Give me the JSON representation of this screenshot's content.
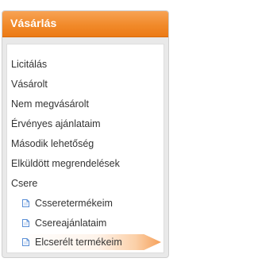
{
  "panel": {
    "title": "Vásárlás"
  },
  "menu": {
    "items": [
      {
        "label": "Licitálás"
      },
      {
        "label": "Vásárolt"
      },
      {
        "label": "Nem megvásárolt"
      },
      {
        "label": "Érvényes ajánlataim"
      },
      {
        "label": "Második lehetőség"
      },
      {
        "label": "Elküldött megrendelések"
      },
      {
        "label": "Csere"
      }
    ],
    "subitems": [
      {
        "label": "Csseretermékeim",
        "icon": "document-icon",
        "active": false
      },
      {
        "label": "Csereajánlataim",
        "icon": "document-icon",
        "active": false
      },
      {
        "label": "Elcserélt termékeim",
        "icon": "document-icon",
        "active": true
      }
    ]
  },
  "colors": {
    "header": "#f18a2a",
    "active_highlight": "#f6a05a",
    "doc_icon": "#5b8fd6"
  }
}
